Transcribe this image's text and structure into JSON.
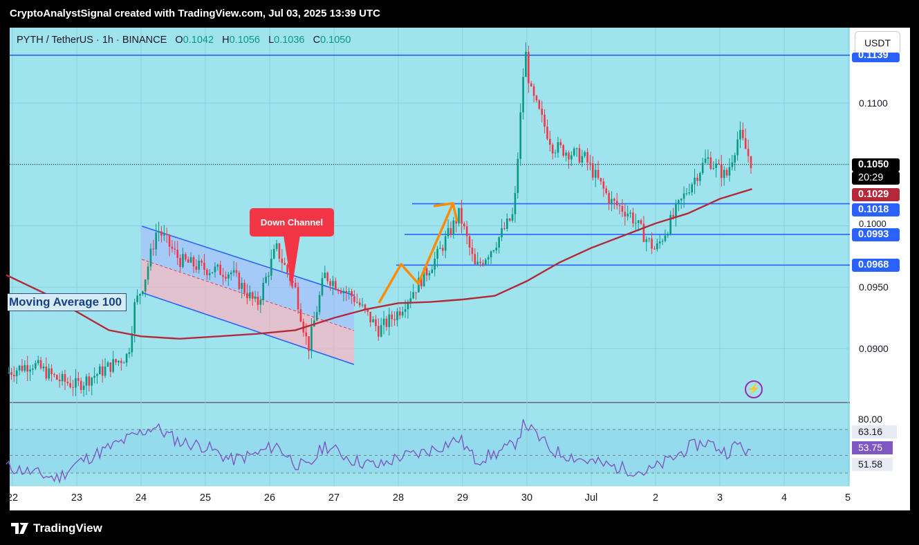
{
  "header": {
    "caption": "CryptoAnalystSignal created with TradingView.com, Jul 03, 2025 13:39 UTC"
  },
  "legend": {
    "symbol": "PYTH / TetherUS · 1h · BINANCE",
    "o_label": "O",
    "o_value": "0.1042",
    "h_label": "H",
    "h_value": "0.1056",
    "l_label": "L",
    "l_value": "0.1036",
    "c_label": "C",
    "c_value": "0.1050"
  },
  "currency_button": "USDT",
  "colors": {
    "chart_bg": "#9fe3ef",
    "bull": "#089981",
    "bear": "#f23645",
    "ma": "#b22a39",
    "level": "#2962ff",
    "rsi": "#7e57c2",
    "arrow": "#ff8c00"
  },
  "annotations": {
    "down_channel": "Down Channel",
    "ma_label": "Moving Average 100"
  },
  "price_tags": {
    "top_level": "0.1139",
    "current": "0.1050",
    "countdown": "20:29",
    "ma": "0.1029",
    "res1": "0.1018",
    "res2": "0.0993",
    "res3": "0.0968"
  },
  "y_ticks": [
    "0.1100",
    "0.1000",
    "0.0950",
    "0.0900"
  ],
  "rsi_tags": {
    "upper": "80.00",
    "signal": "63.16",
    "value": "53.75",
    "lower": "51.58"
  },
  "x_ticks": [
    "22",
    "23",
    "24",
    "25",
    "26",
    "27",
    "28",
    "29",
    "30",
    "Jul",
    "2",
    "3",
    "4",
    "5"
  ],
  "footer": {
    "brand": "TradingView",
    "icon": "tradingview-logo-icon"
  },
  "chart_data": {
    "type": "candlestick",
    "title": "PYTH / TetherUS · 1h · BINANCE",
    "ylim": [
      0.0878,
      0.1155
    ],
    "x_ticks": [
      "22",
      "23",
      "24",
      "25",
      "26",
      "27",
      "28",
      "29",
      "30",
      "Jul",
      "2",
      "3",
      "4",
      "5"
    ],
    "horizontal_levels": [
      0.1139,
      0.1018,
      0.0993,
      0.0968
    ],
    "close_line": 0.105,
    "ma100_last": 0.1029,
    "price_path": [
      [
        21.9,
        0.088
      ],
      [
        22.3,
        0.0888
      ],
      [
        22.7,
        0.0875
      ],
      [
        23.0,
        0.087
      ],
      [
        23.4,
        0.0882
      ],
      [
        23.8,
        0.0895
      ],
      [
        23.9,
        0.0935
      ],
      [
        24.05,
        0.0955
      ],
      [
        24.25,
        0.0998
      ],
      [
        24.6,
        0.0972
      ],
      [
        25.0,
        0.0965
      ],
      [
        25.4,
        0.0962
      ],
      [
        25.8,
        0.0935
      ],
      [
        26.1,
        0.0982
      ],
      [
        26.4,
        0.0948
      ],
      [
        26.6,
        0.09
      ],
      [
        26.85,
        0.096
      ],
      [
        27.3,
        0.0942
      ],
      [
        27.7,
        0.0915
      ],
      [
        28.0,
        0.093
      ],
      [
        28.3,
        0.0952
      ],
      [
        28.6,
        0.0975
      ],
      [
        28.95,
        0.101
      ],
      [
        29.2,
        0.0965
      ],
      [
        29.5,
        0.0985
      ],
      [
        29.8,
        0.101
      ],
      [
        29.97,
        0.1145
      ],
      [
        30.05,
        0.111
      ],
      [
        30.4,
        0.1065
      ],
      [
        30.9,
        0.1055
      ],
      [
        31.3,
        0.102
      ],
      [
        31.6,
        0.101
      ],
      [
        31.85,
        0.099
      ],
      [
        32.0,
        0.098
      ],
      [
        32.3,
        0.101
      ],
      [
        32.5,
        0.103
      ],
      [
        32.8,
        0.1055
      ],
      [
        33.1,
        0.104
      ],
      [
        33.3,
        0.1075
      ],
      [
        33.5,
        0.105
      ]
    ],
    "ma100_path": [
      [
        21.9,
        0.096
      ],
      [
        22.5,
        0.0945
      ],
      [
        23.0,
        0.093
      ],
      [
        23.5,
        0.0915
      ],
      [
        24.0,
        0.091
      ],
      [
        24.6,
        0.0908
      ],
      [
        25.2,
        0.091
      ],
      [
        25.8,
        0.0912
      ],
      [
        26.4,
        0.0915
      ],
      [
        27.0,
        0.0925
      ],
      [
        27.5,
        0.0932
      ],
      [
        28.0,
        0.0937
      ],
      [
        28.5,
        0.0938
      ],
      [
        29.0,
        0.094
      ],
      [
        29.5,
        0.0943
      ],
      [
        30.0,
        0.0955
      ],
      [
        30.5,
        0.097
      ],
      [
        31.0,
        0.0982
      ],
      [
        31.5,
        0.0992
      ],
      [
        32.0,
        0.1002
      ],
      [
        32.5,
        0.101
      ],
      [
        33.0,
        0.1022
      ],
      [
        33.5,
        0.103
      ]
    ],
    "rsi": {
      "levels": [
        80.0,
        63.16,
        51.58
      ],
      "last": 53.75,
      "path": [
        [
          21.9,
          56
        ],
        [
          22.3,
          52
        ],
        [
          22.7,
          48
        ],
        [
          23.0,
          58
        ],
        [
          23.4,
          66
        ],
        [
          23.8,
          74
        ],
        [
          24.2,
          82
        ],
        [
          24.6,
          72
        ],
        [
          25.0,
          69
        ],
        [
          25.4,
          60
        ],
        [
          25.8,
          64
        ],
        [
          26.1,
          70
        ],
        [
          26.4,
          58
        ],
        [
          26.6,
          55
        ],
        [
          26.85,
          70
        ],
        [
          27.3,
          60
        ],
        [
          27.7,
          56
        ],
        [
          28.0,
          62
        ],
        [
          28.3,
          64
        ],
        [
          28.6,
          68
        ],
        [
          28.95,
          74
        ],
        [
          29.2,
          60
        ],
        [
          29.5,
          64
        ],
        [
          29.8,
          70
        ],
        [
          29.97,
          85
        ],
        [
          30.05,
          80
        ],
        [
          30.4,
          66
        ],
        [
          30.9,
          60
        ],
        [
          31.3,
          56
        ],
        [
          31.6,
          54
        ],
        [
          31.85,
          52
        ],
        [
          32.0,
          55
        ],
        [
          32.3,
          62
        ],
        [
          32.5,
          68
        ],
        [
          32.8,
          72
        ],
        [
          33.1,
          65
        ],
        [
          33.3,
          71
        ],
        [
          33.5,
          62
        ]
      ]
    }
  }
}
